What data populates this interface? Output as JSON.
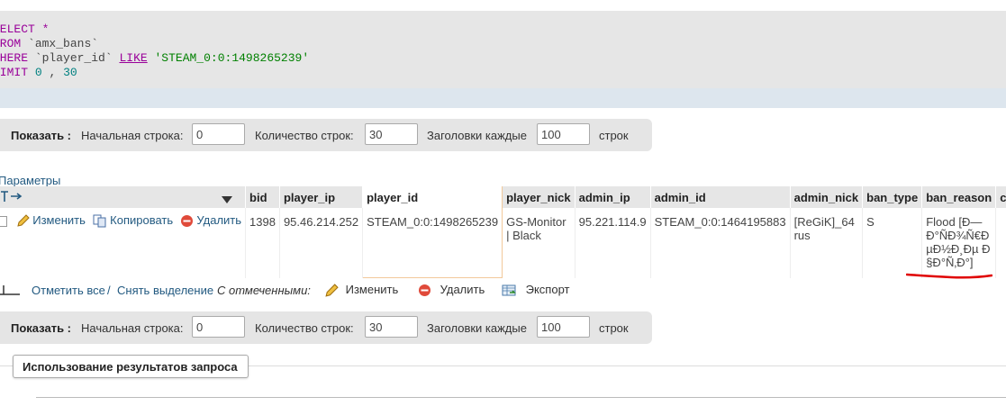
{
  "sql": {
    "select_kw": "SELECT",
    "star": "*",
    "from_kw": "FROM",
    "table": "`amx_bans`",
    "where_kw": "WHERE",
    "column": "`player_id`",
    "like_kw": "LIKE",
    "value": "'STEAM_0:0:1498265239'",
    "limit_kw": "LIMIT",
    "limit_start": "0",
    "limit_sep": ",",
    "limit_count": "30"
  },
  "nav": {
    "show_label": "Показать :",
    "start_row_label": "Начальная строка:",
    "start_row_value": "0",
    "rows_count_label": "Количество строк:",
    "rows_count_value": "30",
    "headers_every_label": "Заголовки каждые",
    "headers_every_value": "100",
    "rows_suffix": "строк"
  },
  "params_link": "Параметры",
  "table": {
    "columns": [
      "bid",
      "player_ip",
      "player_id",
      "player_nick",
      "admin_ip",
      "admin_id",
      "admin_nick",
      "ban_type",
      "ban_reason",
      "cs_b"
    ],
    "row_actions": {
      "edit": "Изменить",
      "copy": "Копировать",
      "delete": "Удалить"
    },
    "row": {
      "bid": "1398",
      "player_ip": "95.46.214.252",
      "player_id": "STEAM_0:0:1498265239",
      "player_nick": "GS-Monitor | Black",
      "admin_ip": "95.221.114.9",
      "admin_id": "STEAM_0:0:1464195883",
      "admin_nick": "[ReGiK]_64 rus",
      "ban_type": "S",
      "ban_reason": "Flood [Ð—Ð°ÑÐ¾Ñ€ÐµÐ½Ð¸Ðµ Ð§Ð°Ñ‚Ð°]"
    }
  },
  "bulk": {
    "check_all": "Отметить все",
    "separator": "/",
    "uncheck_all": "Снять выделение",
    "with_selected": "С отмеченными:",
    "edit": "Изменить",
    "delete": "Удалить",
    "export": "Экспорт"
  },
  "results_usage": "Использование результатов запроса",
  "colors": {
    "link": "#235a81",
    "keyword": "#990099",
    "string": "#008000",
    "number": "#008080",
    "annotation": "#e00000"
  }
}
